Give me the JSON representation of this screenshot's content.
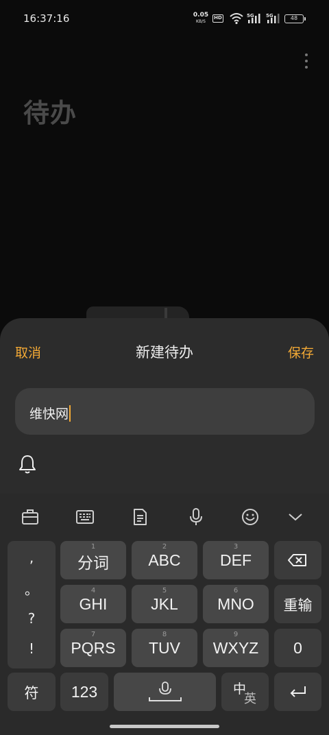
{
  "status": {
    "time": "16:37:16",
    "net_speed_value": "0.05",
    "net_speed_unit": "KB/S",
    "hd_badge": "HD",
    "signal1_label": "5G",
    "signal2_label": "5G",
    "battery": "48"
  },
  "page": {
    "title": "待办"
  },
  "sheet": {
    "cancel_label": "取消",
    "title": "新建待办",
    "save_label": "保存",
    "input_value": "维快网"
  },
  "keyboard": {
    "punctuation": [
      ",",
      "。",
      "?",
      "!"
    ],
    "rows": [
      [
        {
          "hint": "1",
          "label": "分词"
        },
        {
          "hint": "2",
          "label": "ABC"
        },
        {
          "hint": "3",
          "label": "DEF"
        }
      ],
      [
        {
          "hint": "4",
          "label": "GHI"
        },
        {
          "hint": "5",
          "label": "JKL"
        },
        {
          "hint": "6",
          "label": "MNO"
        }
      ],
      [
        {
          "hint": "7",
          "label": "PQRS"
        },
        {
          "hint": "8",
          "label": "TUV"
        },
        {
          "hint": "9",
          "label": "WXYZ"
        }
      ]
    ],
    "relearn_label": "重输",
    "zero_label": "0",
    "symbol_label": "符",
    "numeric_label": "123",
    "lang_cn": "中",
    "lang_en": "英"
  },
  "colors": {
    "accent": "#f3a935",
    "sheet_bg": "#2c2c2c",
    "key_bg": "#474747"
  }
}
